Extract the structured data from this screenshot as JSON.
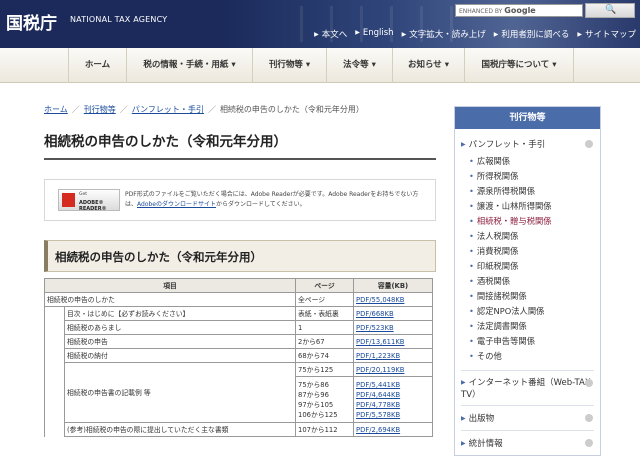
{
  "header": {
    "logo_jp": "国税庁",
    "logo_en": "NATIONAL TAX AGENCY",
    "search": {
      "placeholder": "ENHANCED BY",
      "brand": "Google"
    },
    "util_nav": [
      "本文へ",
      "English",
      "文字拡大・読み上げ",
      "利用者別に調べる",
      "サイトマップ"
    ]
  },
  "gnav": [
    "ホーム",
    "税の情報・手続・用紙",
    "刊行物等",
    "法令等",
    "お知らせ",
    "国税庁等について"
  ],
  "breadcrumb": {
    "items": [
      "ホーム",
      "刊行物等",
      "パンフレット・手引"
    ],
    "current": "相続税の申告のしかた（令和元年分用）"
  },
  "page_title": "相続税の申告のしかた（令和元年分用）",
  "adobe": {
    "badge_top": "Get",
    "badge_main": "ADOBE® READER®",
    "line1": "PDF形式のファイルをご覧いただく場合には、Adobe Readerが必要です。Adobe Readerをお持ちでない方",
    "line2_pre": "は、",
    "line2_link": "Adobeのダウンロードサイト",
    "line2_post": "からダウンロードしてください。"
  },
  "section_heading": "相続税の申告のしかた（令和元年分用）",
  "table": {
    "headers": [
      "項目",
      "ページ",
      "容量(KB)"
    ],
    "rows": [
      {
        "item": "相続税の申告のしかた",
        "page": "全ページ",
        "size": "PDF/55,048KB"
      },
      {
        "item": "目次・はじめに【必ずお読みください】",
        "page": "表紙・表紙裏",
        "size": "PDF/668KB"
      },
      {
        "item": "相続税のあらまし",
        "page": "1",
        "size": "PDF/523KB"
      },
      {
        "item": "相続税の申告",
        "page": "2から67",
        "size": "PDF/13,611KB"
      },
      {
        "item": "相続税の納付",
        "page": "68から74",
        "size": "PDF/1,223KB"
      }
    ],
    "example": {
      "item": "相続税の申告書の記載例 等",
      "page": "75から125",
      "size": "PDF/20,119KB",
      "sub": [
        {
          "page": "75から86",
          "size": "PDF/5,441KB"
        },
        {
          "page": "87から96",
          "size": "PDF/4,644KB"
        },
        {
          "page": "97から105",
          "size": "PDF/4,778KB"
        },
        {
          "page": "106から125",
          "size": "PDF/5,578KB"
        }
      ]
    },
    "last": {
      "item": "(参考)相続税の申告の際に提出していただく主な書類",
      "page": "107から112",
      "size": "PDF/2,694KB"
    }
  },
  "sidebar": {
    "title": "刊行物等",
    "cat1": "パンフレット・手引",
    "sub_items": [
      "広報関係",
      "所得税関係",
      "源泉所得税関係",
      "譲渡・山林所得関係",
      "相続税・贈与税関係",
      "法人税関係",
      "消費税関係",
      "印紙税関係",
      "酒税関係",
      "間接諸税関係",
      "認定NPO法人関係",
      "法定調書関係",
      "電子申告等関係",
      "その他"
    ],
    "active_index": 4,
    "cat2": "インターネット番組（Web-TAX-TV）",
    "cat3": "出版物",
    "cat4": "統計情報"
  },
  "colors": {
    "header_bg": "#1b2a5a",
    "sidebar_head": "#4a6ca8",
    "link": "#1a4c9b",
    "active": "#8b1c3c"
  }
}
